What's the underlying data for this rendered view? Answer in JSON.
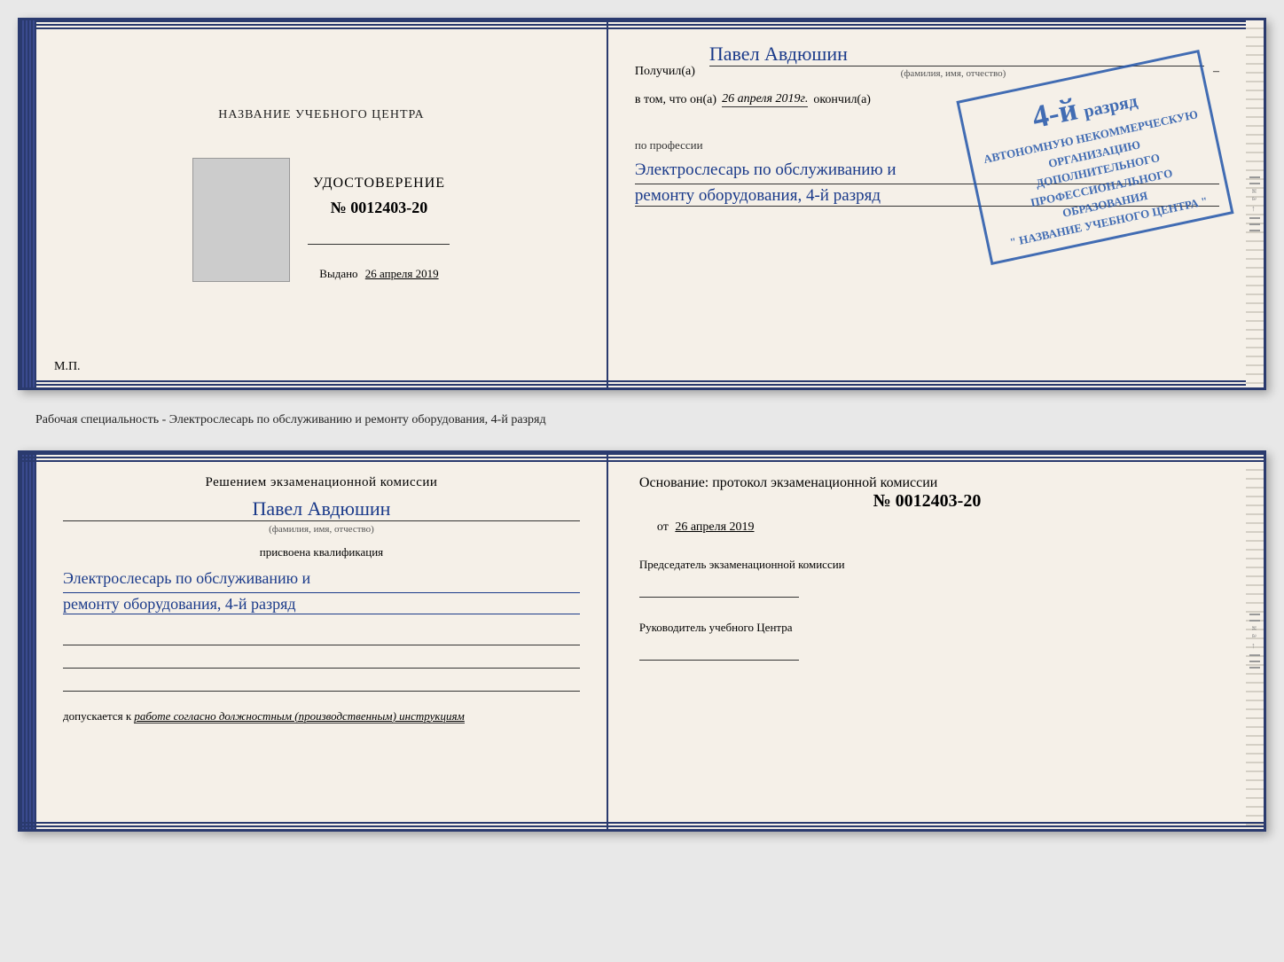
{
  "top_document": {
    "left": {
      "center_title": "НАЗВАНИЕ УЧЕБНОГО ЦЕНТРА",
      "udostoverenie_label": "УДОСТОВЕРЕНИЕ",
      "number": "№ 0012403-20",
      "vydano_label": "Выдано",
      "vydano_date": "26 апреля 2019",
      "mp_label": "М.П."
    },
    "right": {
      "poluchil_label": "Получил(а)",
      "recipient_name": "Павел Авдюшин",
      "fio_sublabel": "(фамилия, имя, отчество)",
      "vtom_prefix": "в том, что он(а)",
      "date_value": "26 апреля 2019г.",
      "okonchil_label": "окончил(а)",
      "stamp_line1": "АВТОНОМНУЮ НЕКОММЕРЧЕСКУЮ ОРГАНИЗАЦИЮ",
      "stamp_line2": "ДОПОЛНИТЕЛЬНОГО ПРОФЕССИОНАЛЬНОГО ОБРАЗОВАНИЯ",
      "stamp_line3": "\" НАЗВАНИЕ УЧЕБНОГО ЦЕНТРА \"",
      "stamp_number": "4-й",
      "stamp_suffix": "разряд",
      "profession_label": "по профессии",
      "profession_line1": "Электрослесарь по обслуживанию и",
      "profession_line2": "ремонту оборудования, 4-й разряд"
    }
  },
  "separator": {
    "text": "Рабочая специальность - Электрослесарь по обслуживанию и ремонту оборудования, 4-й разряд"
  },
  "bottom_document": {
    "left": {
      "commission_title": "Решением экзаменационной комиссии",
      "person_name": "Павел Авдюшин",
      "fio_sublabel": "(фамилия, имя, отчество)",
      "prisvoena_label": "присвоена квалификация",
      "qualification_line1": "Электрослесарь по обслуживанию и",
      "qualification_line2": "ремонту оборудования, 4-й разряд",
      "dopuskaetsya_prefix": "допускается к",
      "dopuskaetsya_value": "работе согласно должностным (производственным) инструкциям"
    },
    "right": {
      "osnovanje_label": "Основание: протокол экзаменационной комиссии",
      "protocol_number": "№  0012403-20",
      "from_label": "от",
      "from_date": "26 апреля 2019",
      "chairman_label": "Председатель экзаменационной комиссии",
      "rukovoditel_label": "Руководитель учебного Центра"
    }
  },
  "colors": {
    "border": "#2a3a6e",
    "blue_text": "#1a3a8a",
    "stamp_blue": "#2255aa",
    "background": "#f5f0e8",
    "page_bg": "#e8e8e8"
  }
}
